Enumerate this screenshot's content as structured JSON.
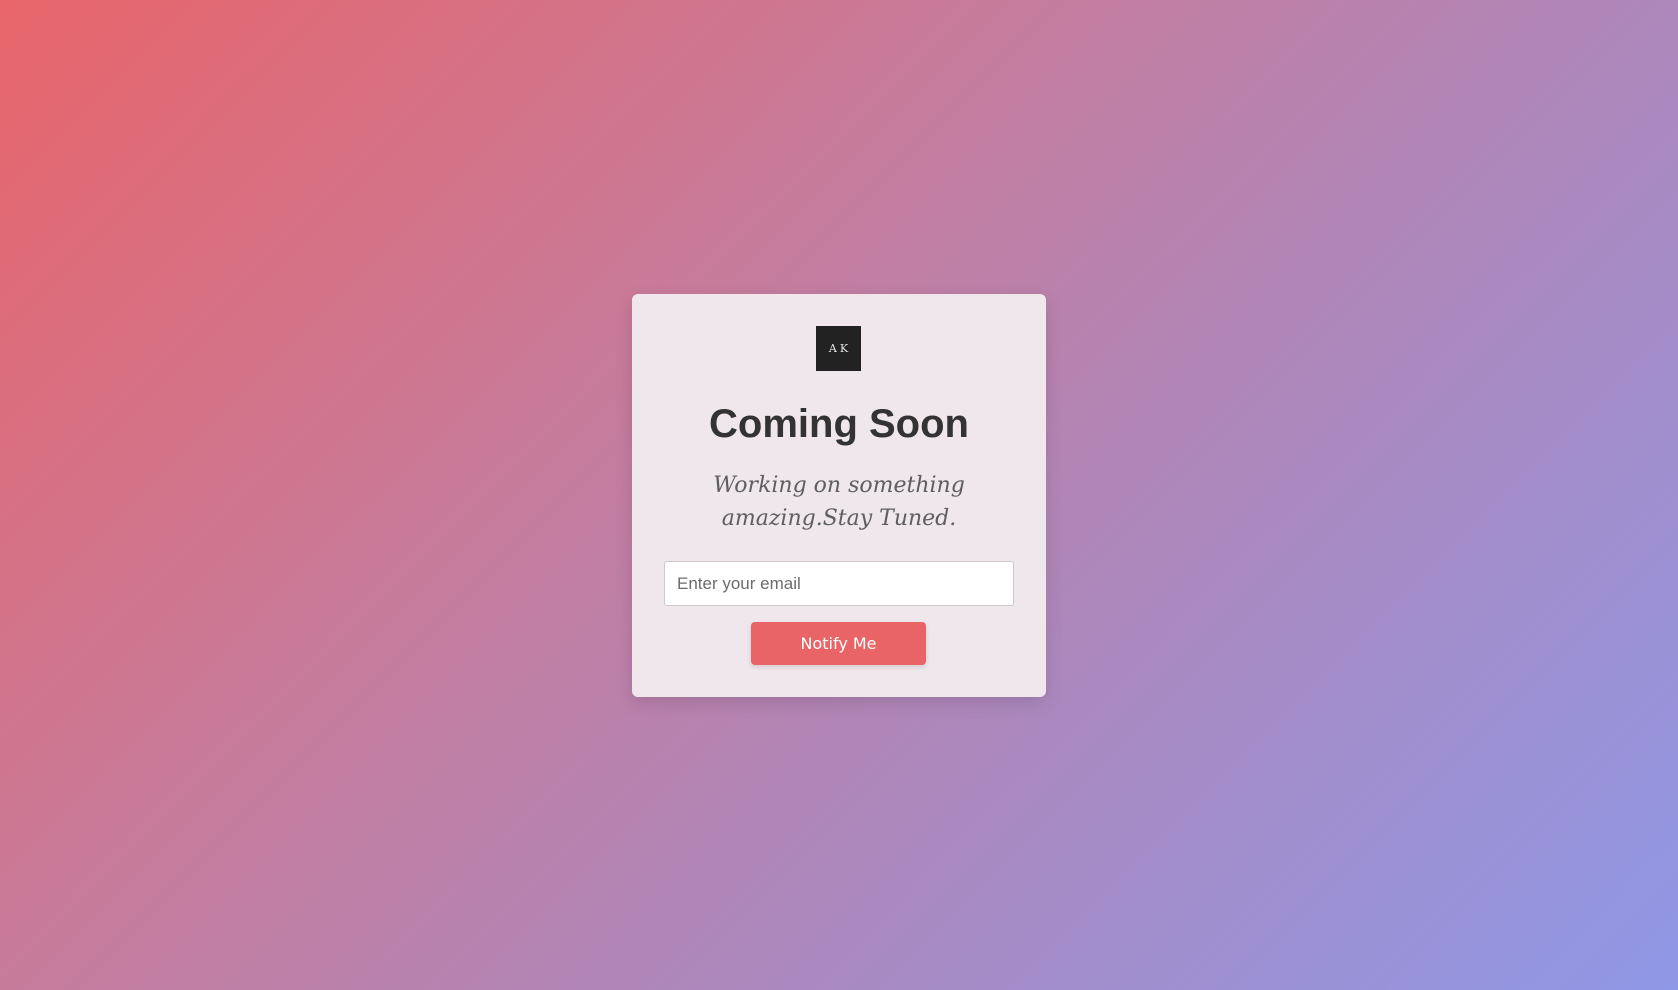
{
  "logo": {
    "text": "AK"
  },
  "heading": "Coming Soon",
  "tagline": "Working on something amazing.Stay Tuned.",
  "form": {
    "email_placeholder": "Enter your email",
    "email_value": "",
    "submit_label": "Notify Me"
  },
  "colors": {
    "gradient_start": "#e8656a",
    "gradient_end": "#8f98e6",
    "card_bg": "#efe7ec",
    "button_bg": "#e86466",
    "logo_bg": "#222222",
    "heading_text": "#333333"
  }
}
